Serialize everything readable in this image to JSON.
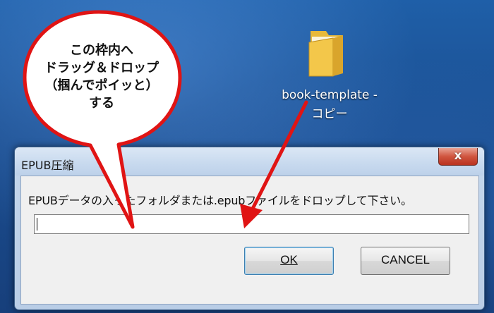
{
  "desktop": {
    "folder_icon": "folder-icon",
    "folder_label_line1": "book-template -",
    "folder_label_line2": "コピー"
  },
  "dialog": {
    "title": "EPUB圧縮",
    "close_glyph": "x",
    "instruction": "EPUBデータの入ったフォルダまたは.epubファイルをドロップして下さい。",
    "input_value": "",
    "ok_label": "OK",
    "cancel_label": "CANCEL"
  },
  "annotation": {
    "lines": [
      "この枠内へ",
      "ドラッグ＆ドロップ",
      "（掴んでポイッと）",
      "する"
    ],
    "bubble_border_color": "#e01414",
    "arrow_color": "#e01414"
  }
}
